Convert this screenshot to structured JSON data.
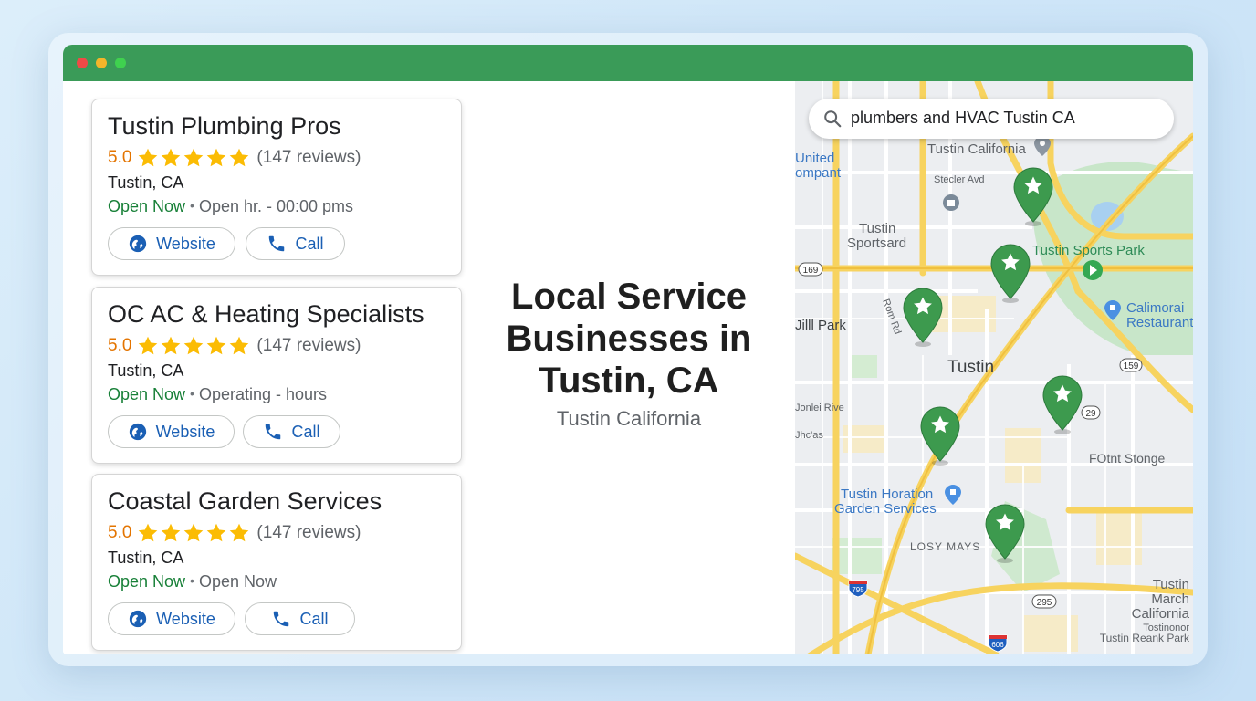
{
  "hero": {
    "title": "Local Service Businesses in Tustin, CA",
    "subtitle": "Tustin California"
  },
  "cards": [
    {
      "name": "Tustin Plumbing Pros",
      "rating": "5.0",
      "reviews": "(147 reviews)",
      "city": "Tustin, CA",
      "status": "Open Now",
      "hours": "Open hr. - 00:00 pms",
      "website_label": "Website",
      "call_label": "Call"
    },
    {
      "name": "OC AC & Heating Specialists",
      "rating": "5.0",
      "reviews": "(147 reviews)",
      "city": "Tustin, CA",
      "status": "Open Now",
      "hours": "Operating - hours",
      "website_label": "Website",
      "call_label": "Call"
    },
    {
      "name": "Coastal Garden Services",
      "rating": "5.0",
      "reviews": "(147 reviews)",
      "city": "Tustin, CA",
      "status": "Open Now",
      "hours": "Open Now",
      "website_label": "Website",
      "call_label": "Call"
    }
  ],
  "map": {
    "search_query": "plumbers and HVAC Tustin CA",
    "labels": {
      "tustin_california": "Tustin California",
      "stecler": "Stecler Avd",
      "united": "United",
      "company": "ompant",
      "sportsard_1": "Tustin",
      "sportsard_2": "Sportsard",
      "sports_park": "Tustin Sports Park",
      "calimorai_1": "Calimorai",
      "calimorai_2": "Restaurant",
      "ramp": "Rom Rd",
      "mill_park": "Jilll Park",
      "tustin": "Tustin",
      "donlei": "Jonlei Rive",
      "chcas": "Jhc'as",
      "fount_stonge": "FOtnt Stonge",
      "horation_1": "Tustin Horation",
      "horation_2": "Garden Services",
      "losy_mays": "LOSY MAYS",
      "march_1": "Tustin",
      "march_2": "March",
      "march_3": "California",
      "tostinonor": "Tostinonor",
      "reank": "Tustin Reank Park"
    },
    "shields": {
      "r169": "169",
      "r159": "159",
      "r29": "29",
      "r295": "295",
      "r795": "795",
      "r606": "606"
    }
  },
  "colors": {
    "titlebar": "#3a9b58",
    "star": "#fbbc04",
    "rating": "#e37400",
    "open": "#188038",
    "link": "#1a5fb4",
    "pin": "#3d9a4e",
    "road": "#f7d35f"
  },
  "icons": [
    "globe-icon",
    "phone-icon",
    "star-icon",
    "search-icon",
    "map-pin-icon"
  ]
}
